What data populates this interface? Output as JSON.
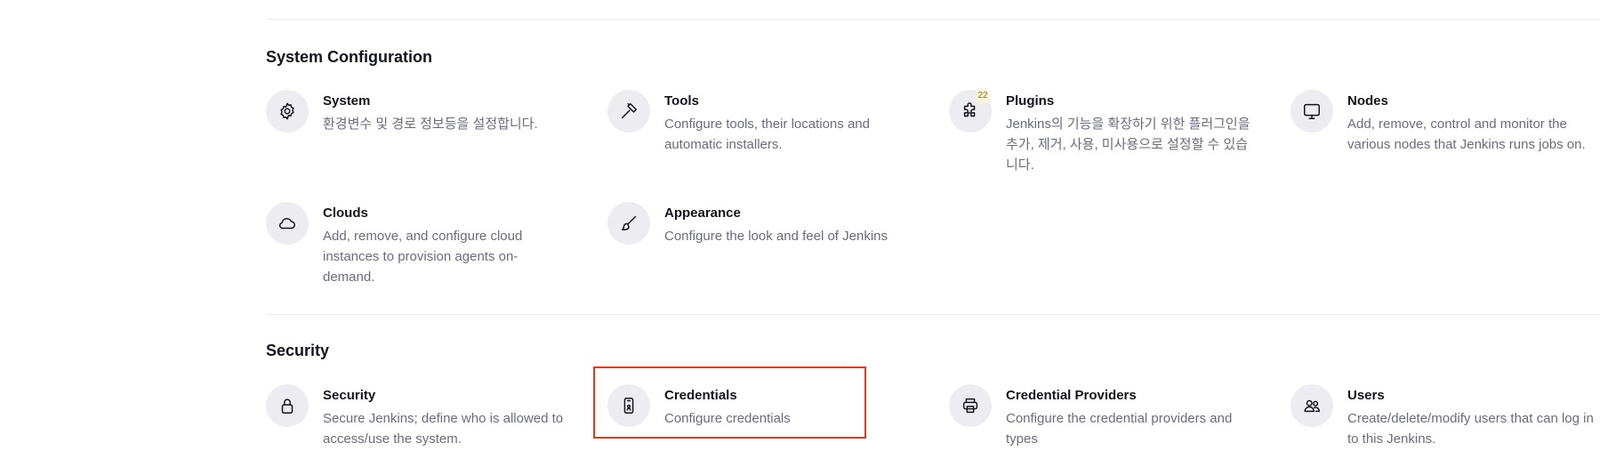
{
  "sections": [
    {
      "title": "System Configuration",
      "items": [
        {
          "title": "System",
          "description": "환경변수 및 경로 정보등을 설정합니다.",
          "icon": "gear-icon"
        },
        {
          "title": "Tools",
          "description": "Configure tools, their locations and automatic installers.",
          "icon": "hammer-icon"
        },
        {
          "title": "Plugins",
          "description": "Jenkins의 기능을 확장하기 위한 플러그인을 추가, 제거, 사용, 미사용으로 설정할 수 있습니다.",
          "icon": "puzzle-icon",
          "badge": "22"
        },
        {
          "title": "Nodes",
          "description": "Add, remove, control and monitor the various nodes that Jenkins runs jobs on.",
          "icon": "monitor-icon"
        },
        {
          "title": "Clouds",
          "description": "Add, remove, and configure cloud instances to provision agents on-demand.",
          "icon": "cloud-icon"
        },
        {
          "title": "Appearance",
          "description": "Configure the look and feel of Jenkins",
          "icon": "brush-icon"
        }
      ]
    },
    {
      "title": "Security",
      "items": [
        {
          "title": "Security",
          "description": "Secure Jenkins; define who is allowed to access/use the system.",
          "icon": "lock-icon"
        },
        {
          "title": "Credentials",
          "description": "Configure credentials",
          "icon": "id-card-icon"
        },
        {
          "title": "Credential Providers",
          "description": "Configure the credential providers and types",
          "icon": "printer-icon"
        },
        {
          "title": "Users",
          "description": "Create/delete/modify users that can log in to this Jenkins.",
          "icon": "users-icon"
        }
      ]
    }
  ],
  "colors": {
    "highlight": "#e5391f",
    "badge_bg": "#fdf3d8",
    "icon_bg": "#ededf1",
    "description": "#6b6b80"
  }
}
